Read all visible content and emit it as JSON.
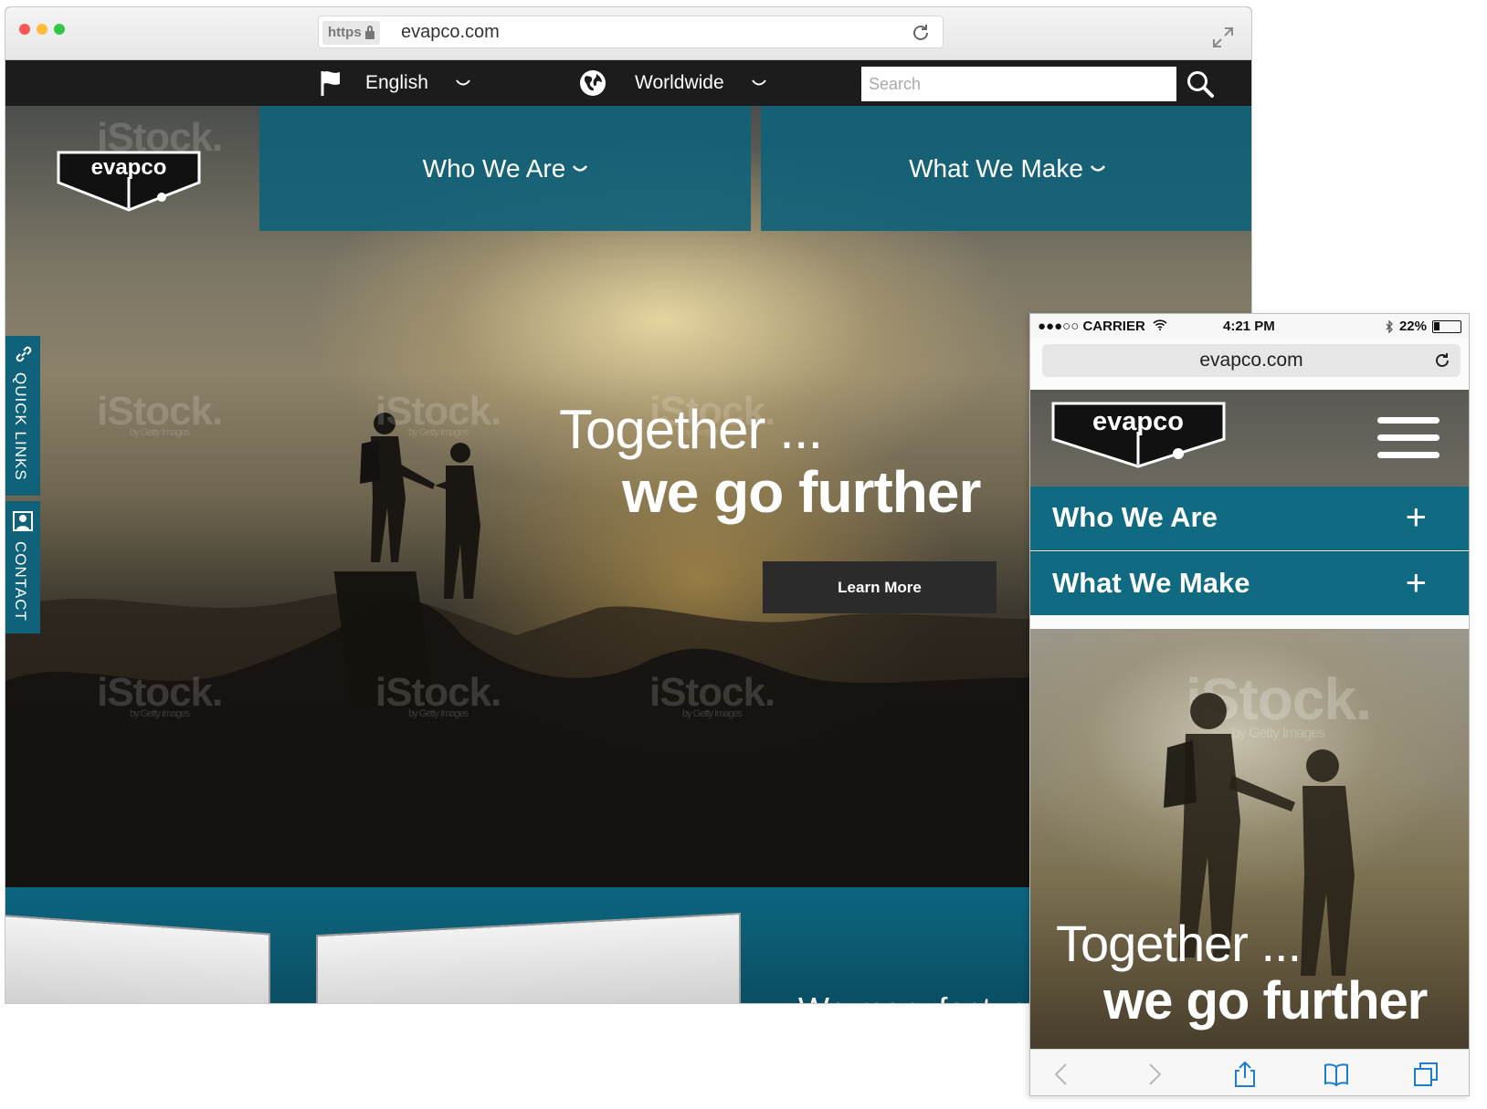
{
  "desktop": {
    "browser": {
      "protocol_badge": "https",
      "url": "evapco.com"
    },
    "topnav": {
      "language": "English",
      "region": "Worldwide",
      "search_placeholder": "Search"
    },
    "logo_text": "evapco",
    "menu": [
      {
        "label": "Who We Are"
      },
      {
        "label": "What We Make"
      }
    ],
    "hero": {
      "line1": "Together ...",
      "line2": "we go further",
      "cta": "Learn More"
    },
    "side_tabs": {
      "quick_links": "QUICK LINKS",
      "contact": "CONTACT"
    },
    "lower_teaser": "We manufacture m",
    "watermark": {
      "brand": "iStock.",
      "sub": "by Getty Images"
    }
  },
  "mobile": {
    "status": {
      "carrier": "●●●○○ CARRIER",
      "time": "4:21 PM",
      "battery": "22%",
      "battery_level": 0.22
    },
    "url": "evapco.com",
    "logo_text": "evapco",
    "menu": [
      {
        "label": "Who We Are",
        "icon": "+"
      },
      {
        "label": "What We Make",
        "icon": "+"
      }
    ],
    "hero": {
      "line1": "Together ...",
      "line2": "we go further"
    }
  },
  "colors": {
    "brand_teal": "#10627a",
    "nav_dark": "#1c1c1c",
    "button_dark": "#2b2b2b"
  }
}
